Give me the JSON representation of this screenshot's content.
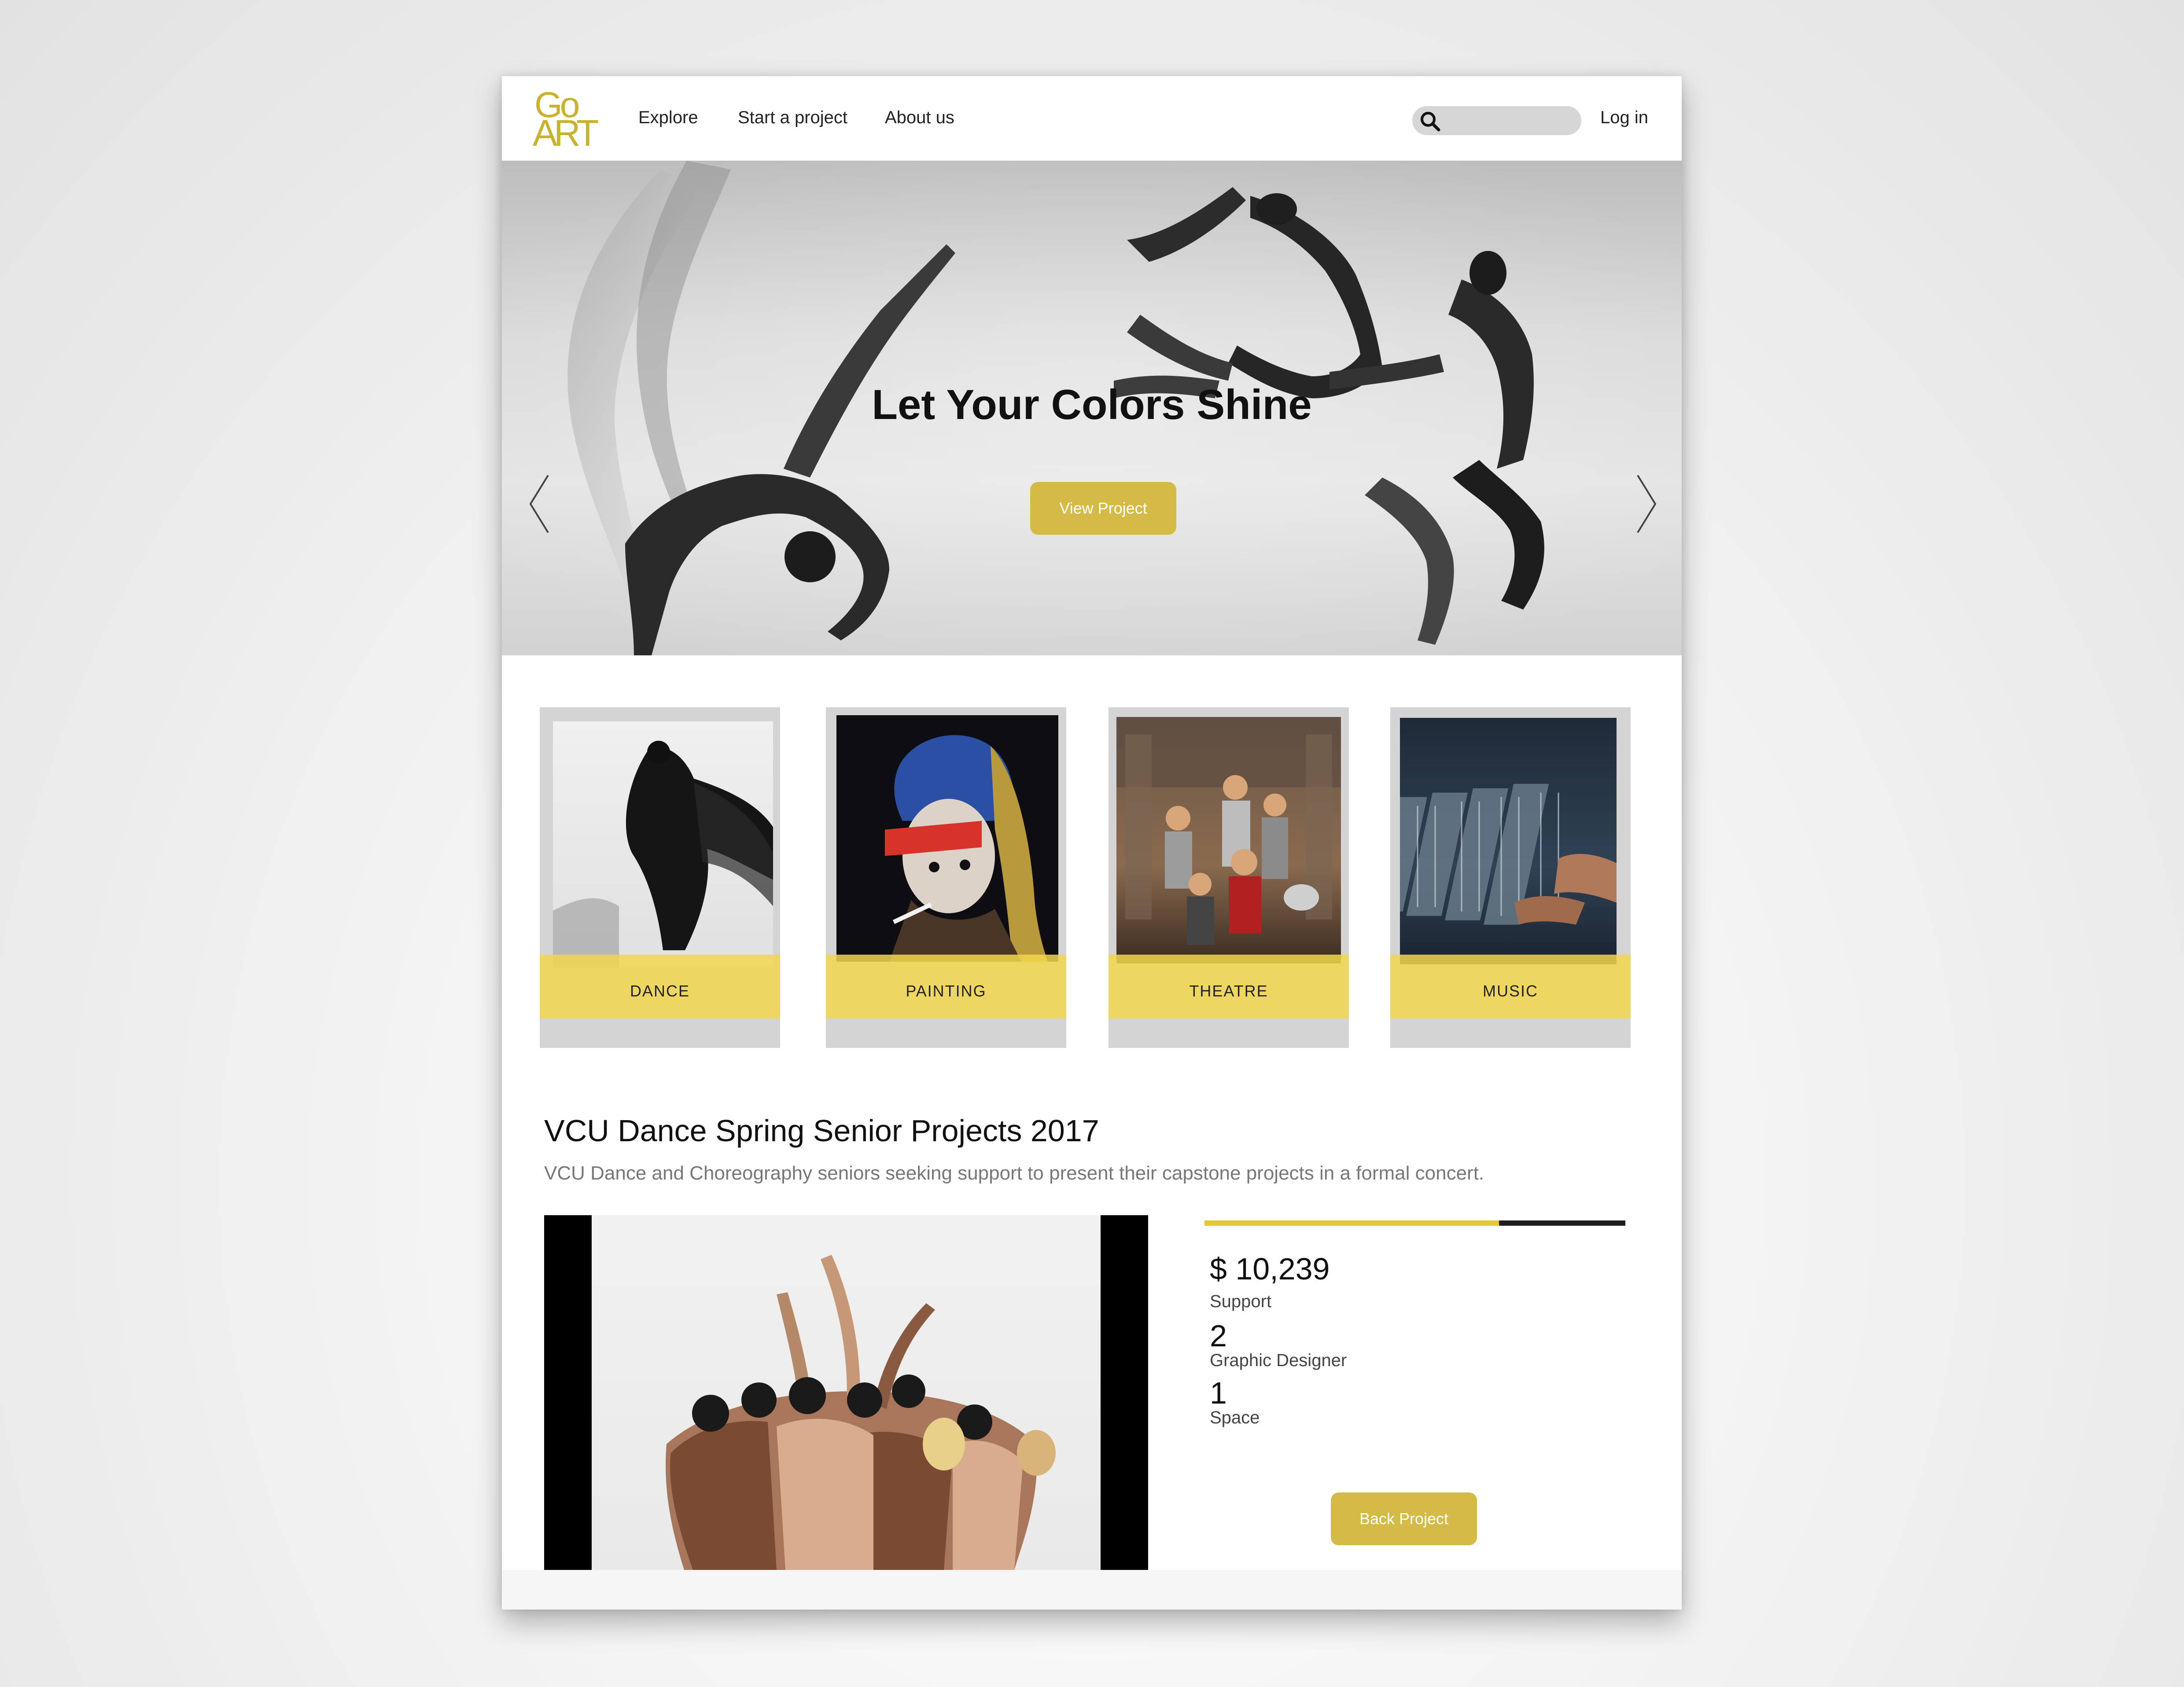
{
  "header": {
    "logo_top": "Go",
    "logo_bottom": "ART",
    "nav": [
      "Explore",
      "Start a project",
      "About us"
    ],
    "search_placeholder": "",
    "login_label": "Log in"
  },
  "hero": {
    "title": "Let Your Colors Shine",
    "button_label": "View Project",
    "slide_count": 6,
    "active_slide": 1
  },
  "categories": [
    {
      "label": "DANCE"
    },
    {
      "label": "PAINTING"
    },
    {
      "label": "THEATRE"
    },
    {
      "label": "MUSIC"
    }
  ],
  "project": {
    "title": "VCU Dance Spring Senior Projects 2017",
    "description": "VCU Dance and Choreography seniors seeking support to present their capstone projects in a formal concert.",
    "progress_fraction": 0.7,
    "stats": [
      {
        "value": "$ 10,239",
        "label": "Support"
      },
      {
        "value": "2",
        "label": "Graphic Designer"
      },
      {
        "value": "1",
        "label": "Space"
      }
    ],
    "button_label": "Back  Project"
  },
  "colors": {
    "accent": "#d4bb45",
    "logo": "#c9b32e",
    "band": "#f2d74b"
  }
}
